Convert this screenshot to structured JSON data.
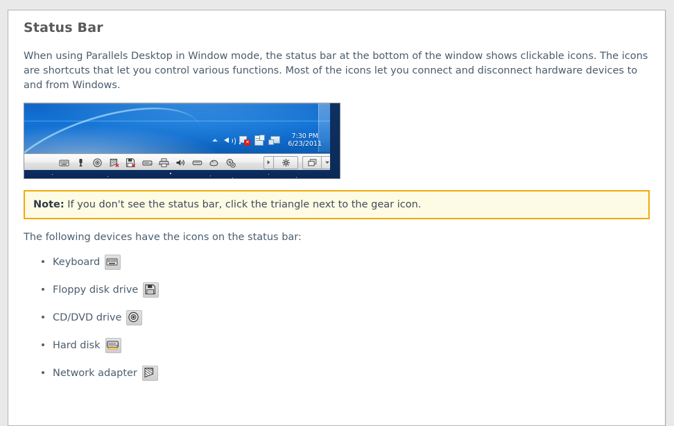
{
  "page": {
    "title": "Status Bar",
    "intro": "When using Parallels Desktop in Window mode, the status bar at the bottom of the window shows clickable icons. The icons are shortcuts that let you control various functions. Most of the icons let you connect and disconnect hardware devices to and from Windows.",
    "list_intro": "The following devices have the icons on the status bar:"
  },
  "note": {
    "label": "Note:",
    "text": "If you don't see the status bar, click the triangle next to the gear icon.",
    "border_color": "#f2a80c",
    "background_color": "#fdfbe4"
  },
  "screenshot": {
    "alt": "windows-status-bar-screenshot",
    "clock": {
      "time": "7:30 PM",
      "date": "6/23/2011"
    },
    "tray_icons": [
      "show-hidden-icons-caret",
      "volume-speaker-icon",
      "network-disconnected-icon",
      "action-center-flag-icon",
      "parallels-tools-icon"
    ],
    "status_bar_icons": [
      "keyboard-icon",
      "usb-icon",
      "cd-dvd-drive-icon",
      "network-adapter-disconnected-icon",
      "floppy-disk-drive-icon",
      "hard-disk-icon",
      "printer-icon",
      "sound-icon",
      "shared-folders-icon",
      "clipboard-icon",
      "settings-cog-icon"
    ],
    "status_bar_buttons": [
      "triangle-button",
      "gear-button",
      "view-mode-button",
      "dropdown-arrow-button"
    ]
  },
  "devices": [
    {
      "label": "Keyboard",
      "icon": "keyboard-icon"
    },
    {
      "label": "Floppy disk drive",
      "icon": "floppy-disk-icon"
    },
    {
      "label": "CD/DVD drive",
      "icon": "cd-dvd-icon"
    },
    {
      "label": "Hard disk",
      "icon": "hard-disk-icon"
    },
    {
      "label": "Network adapter",
      "icon": "network-adapter-icon"
    }
  ]
}
